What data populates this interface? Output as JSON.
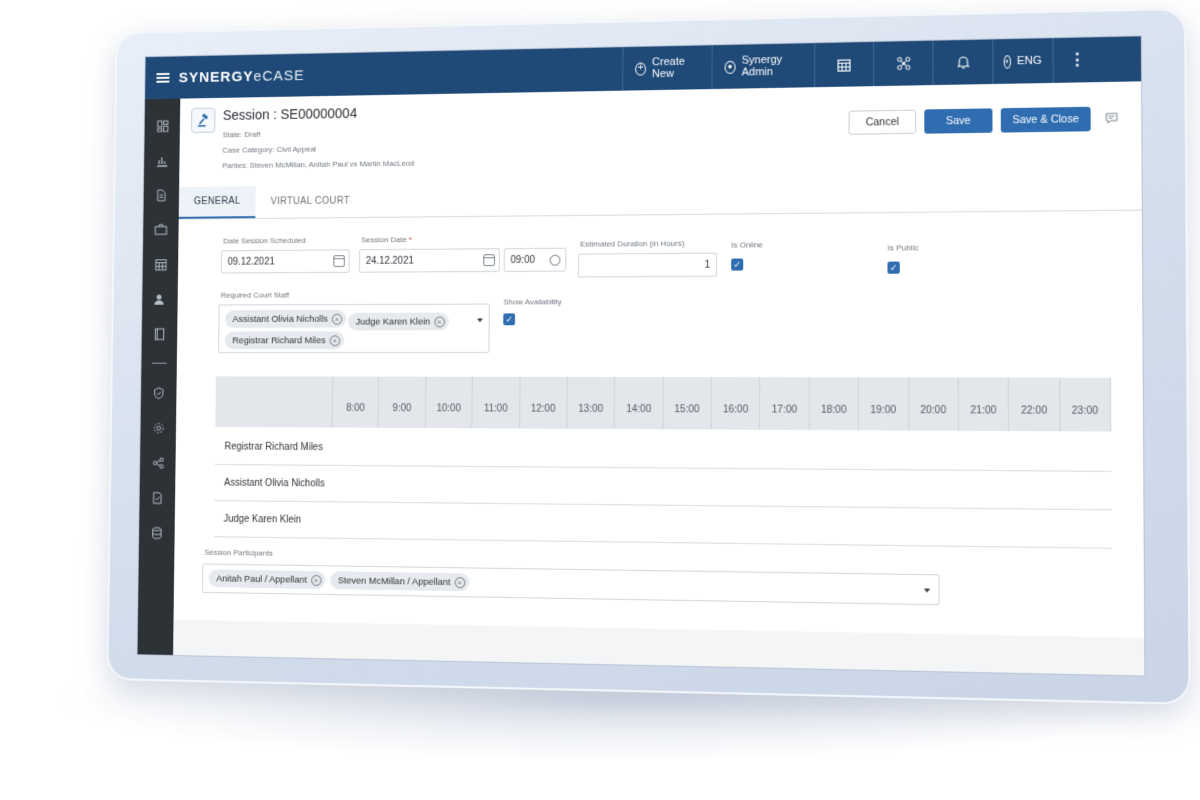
{
  "topbar": {
    "brand_bold": "SYNERGY",
    "brand_light": "eCASE",
    "create_new": "Create New",
    "user": "Synergy Admin",
    "language": "ENG",
    "more": "⋮"
  },
  "session": {
    "title": "Session : SE00000004",
    "state": "State: Draft",
    "case_category": "Case Category: Civil Appeal",
    "parties": "Parties: Steven McMillan, Anitah Paul vs Martin MacLeod"
  },
  "actions": {
    "cancel": "Cancel",
    "save": "Save",
    "save_close": "Save & Close"
  },
  "tabs": [
    "GENERAL",
    "VIRTUAL COURT"
  ],
  "form": {
    "date_scheduled_label": "Date Session Scheduled",
    "date_scheduled_value": "09.12.2021",
    "session_date_label": "Session Date",
    "session_date_required": "*",
    "session_date_value": "24.12.2021",
    "session_time_value": "09:00",
    "duration_label": "Estimated Duration (in Hours)",
    "duration_value": "1",
    "is_online_label": "Is Online",
    "is_online": true,
    "is_public_label": "Is Public",
    "is_public": true,
    "required_staff_label": "Required Court Staff",
    "required_staff": [
      "Assistant Olivia Nicholls",
      "Judge Karen Klein",
      "Registrar Richard Miles"
    ],
    "show_availability_label": "Show Availability",
    "show_availability": true,
    "participants_label": "Session Participants",
    "participants": [
      "Anitah Paul / Appellant",
      "Steven McMillan / Appellant"
    ]
  },
  "schedule": {
    "hours": [
      "8:00",
      "9:00",
      "10:00",
      "11:00",
      "12:00",
      "13:00",
      "14:00",
      "15:00",
      "16:00",
      "17:00",
      "18:00",
      "19:00",
      "20:00",
      "21:00",
      "22:00",
      "23:00"
    ],
    "staff_rows": [
      "Registrar Richard Miles",
      "Assistant Olivia Nicholls",
      "Judge Karen Klein"
    ]
  },
  "colors": {
    "topbar": "#1f4a78",
    "sidebar": "#2d3237",
    "primary_button": "#2f6db0"
  },
  "icons": {
    "sidebar": [
      "dashboard-icon",
      "reports-icon",
      "documents-icon",
      "briefcase-icon",
      "calendar-icon",
      "users-icon",
      "book-icon",
      "shield-icon",
      "gear-icon",
      "workflow-icon",
      "checklist-icon",
      "database-icon"
    ]
  }
}
